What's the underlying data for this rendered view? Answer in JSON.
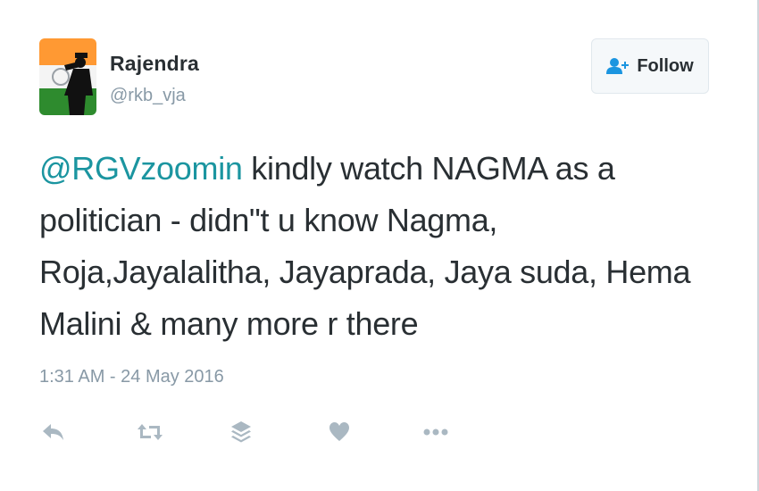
{
  "user": {
    "display_name": "Rajendra",
    "handle": "@rkb_vja",
    "avatar_icon": "saluting-soldier-flag-avatar"
  },
  "follow_button": {
    "label": "Follow",
    "icon": "add-user-icon"
  },
  "tweet": {
    "mention": "@RGVzoomin",
    "line1_rest": " kindly watch NAGMA as a",
    "line2": "politician - didn\"t u know Nagma,",
    "line3": "Roja,Jayalalitha, Jayaprada, Jaya suda, Hema",
    "line4": "Malini & many more r there",
    "timestamp": "1:31 AM - 24 May 2016"
  },
  "actions": [
    {
      "name": "reply",
      "icon": "reply-icon"
    },
    {
      "name": "retweet",
      "icon": "retweet-icon"
    },
    {
      "name": "buffer",
      "icon": "layers-icon"
    },
    {
      "name": "like",
      "icon": "heart-icon"
    },
    {
      "name": "more",
      "icon": "more-icon"
    }
  ],
  "colors": {
    "mention": "#1b95a0",
    "text": "#292f33",
    "muted": "#8899a6",
    "icon": "#aab8c2",
    "follow_icon": "#1b95e0"
  }
}
